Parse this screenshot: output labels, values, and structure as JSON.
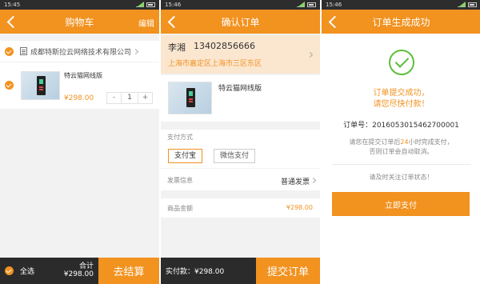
{
  "screen1": {
    "status_time": "15:45",
    "title": "购物车",
    "edit_label": "编辑",
    "store_name": "成都特斯拉云网络技术有限公司",
    "item_name": "特云猫网线版",
    "item_price": "¥298.00",
    "qty_minus": "-",
    "qty_value": "1",
    "qty_plus": "+",
    "select_all_label": "全选",
    "total_label": "合计",
    "total_value": "¥298.00",
    "checkout_label": "去结算"
  },
  "screen2": {
    "status_time": "15:46",
    "title": "确认订单",
    "recipient_name": "李湘",
    "recipient_phone": "13402856666",
    "address": "上海市嘉定区上海市三区东区",
    "item_name": "特云猫网线版",
    "payment_method_label": "支付方式",
    "payment_options": [
      "支付宝",
      "微信支付"
    ],
    "invoice_label": "发票信息",
    "invoice_value": "普通发票",
    "amount_label": "商品金额",
    "amount_value": "¥298.00",
    "actual_pay_label": "实付款：¥298.00",
    "submit_label": "提交订单"
  },
  "screen3": {
    "status_time": "15:46",
    "title": "订单生成成功",
    "success_line1": "订单提交成功，",
    "success_line2": "请您尽快付款！",
    "order_no_label": "订单号：",
    "order_no": "2016053015462700001",
    "notice_prefix": "请您在提交订单后",
    "notice_hours": "24",
    "notice_suffix": "小时完成支付，",
    "notice_line2": "否则订单会自动取消。",
    "reminder": "请及时关注订单状态！",
    "pay_now_label": "立即支付"
  },
  "colors": {
    "accent": "#f2921f",
    "address_bg": "#fbe6cf",
    "success": "#5cbf3a",
    "bottom_bar": "#2b2b2b"
  }
}
